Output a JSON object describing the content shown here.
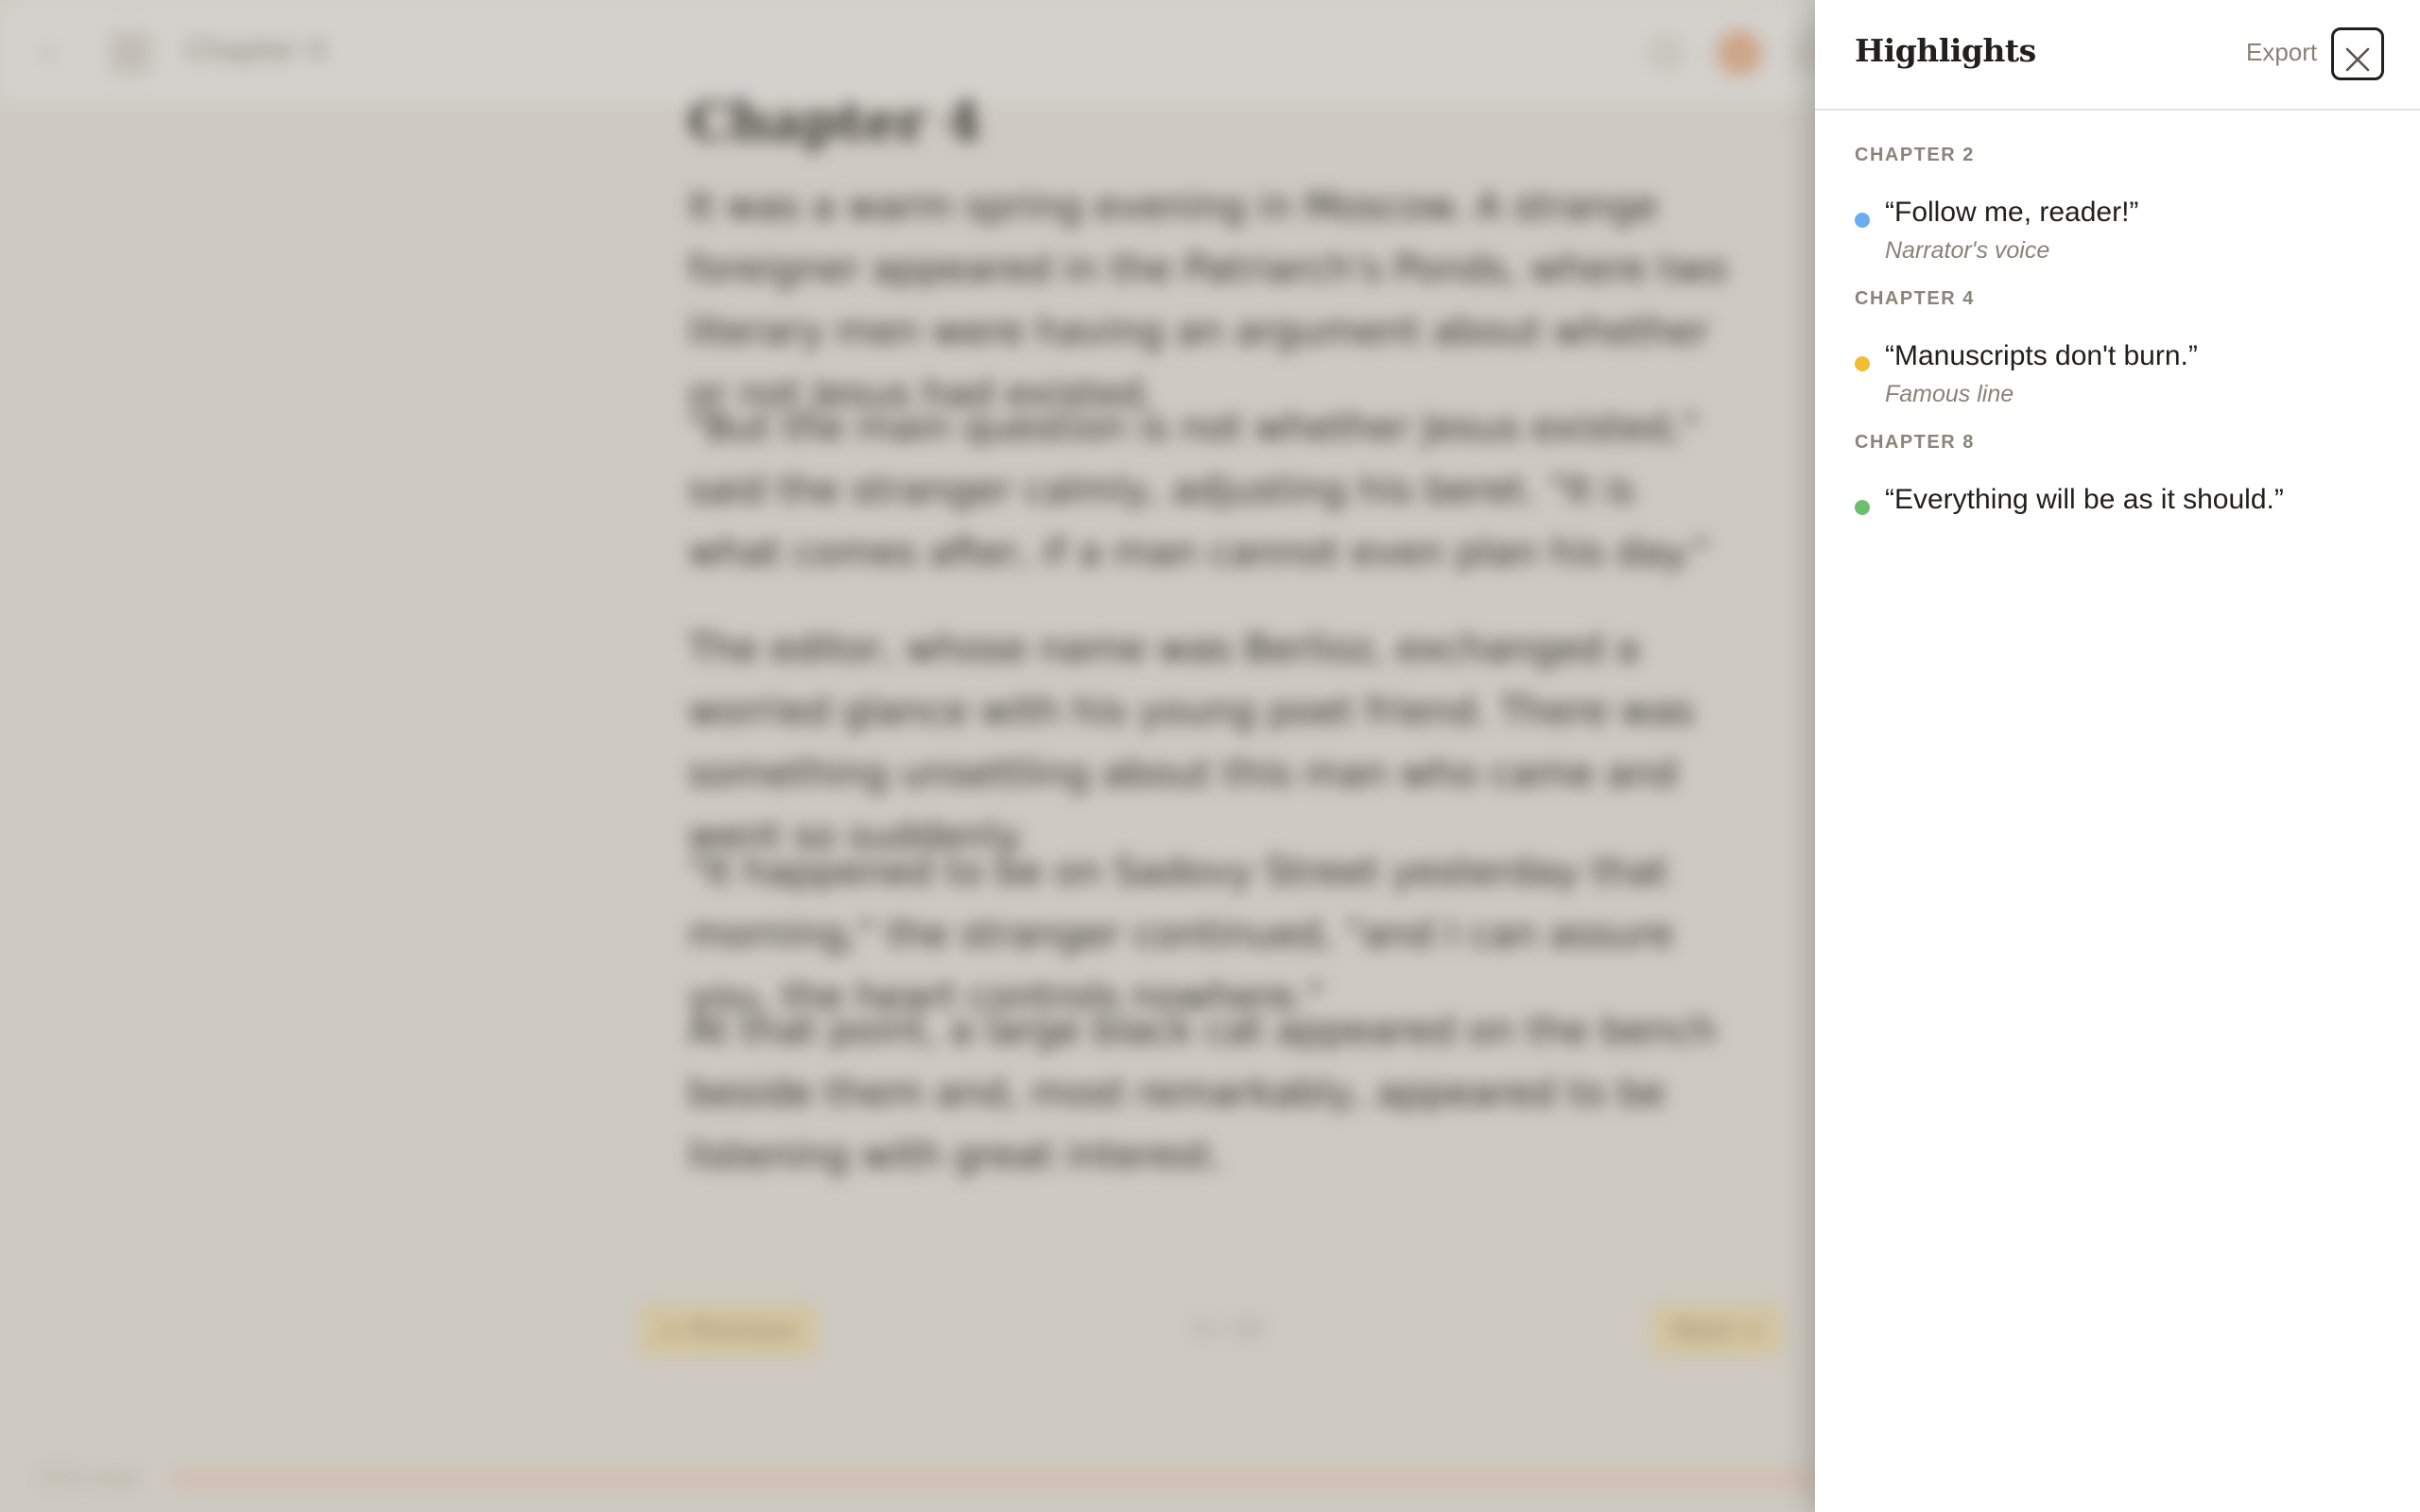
{
  "reader": {
    "app_title": "Chapter 4",
    "chapter_heading": "Chapter 4",
    "paragraphs": [
      "It was a warm spring evening in Moscow. A strange foreigner appeared in the Patriarch's Ponds, where two literary men were having an argument about whether or not Jesus had existed.",
      "\"But the main question is not whether Jesus existed,\" said the stranger calmly, adjusting his beret. \"It is what comes after, if a man cannot even plan his day.\"",
      "The editor, whose name was Berlioz, exchanged a worried glance with his young poet friend. There was something unsettling about this man who came and went so suddenly.",
      "\"It happened to be on Sadovy Street yesterday that morning,\" the stranger continued, \"and I can assure you, the heart controls nowhere.\"",
      "At that point, a large black cat appeared on the bench beside them and, most remarkably, appeared to be listening with great interest."
    ],
    "prev_label": "← Previous",
    "page_indicator": "4 / 32",
    "next_label": "Next →",
    "progress_label": "12% read",
    "progress_fraction": 0.12
  },
  "panel": {
    "title": "Highlights",
    "export_label": "Export",
    "close_icon": "close-icon",
    "groups": [
      {
        "chapter": "CHAPTER 2",
        "items": [
          {
            "quote": "“Follow me, reader!”",
            "note": "Narrator's voice",
            "color": "#6aaef0"
          }
        ]
      },
      {
        "chapter": "CHAPTER 4",
        "items": [
          {
            "quote": "“Manuscripts don't burn.”",
            "note": "Famous line",
            "color": "#f2bd35"
          }
        ]
      },
      {
        "chapter": "CHAPTER 8",
        "items": [
          {
            "quote": "“Everything will be as it should.”",
            "note": "",
            "color": "#6dbf6d"
          }
        ]
      }
    ]
  },
  "colors": {
    "accent_dark": "#22201d",
    "muted": "#8a8276",
    "background_reader": "#d4d0c8"
  }
}
